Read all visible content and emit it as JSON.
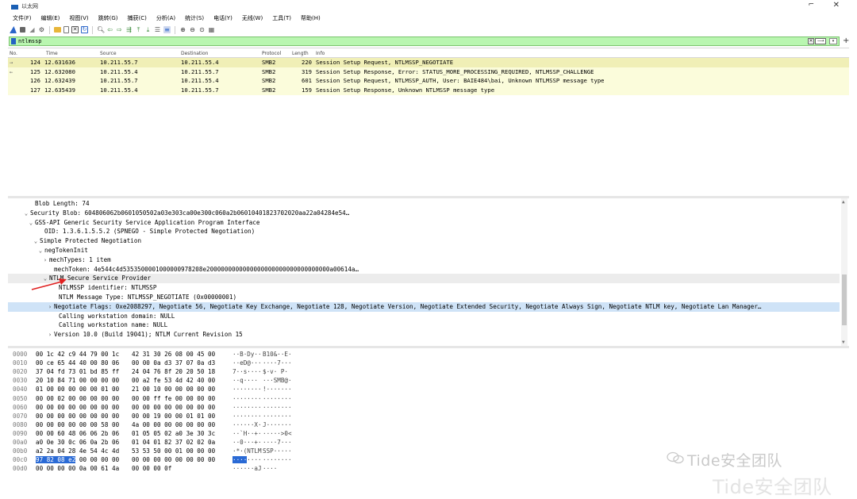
{
  "window": {
    "title": "以太网"
  },
  "menu": [
    "文件(F)",
    "编辑(E)",
    "视图(V)",
    "跳转(G)",
    "捕获(C)",
    "分析(A)",
    "统计(S)",
    "电话(Y)",
    "无线(W)",
    "工具(T)",
    "帮助(H)"
  ],
  "toolbar_icons": [
    "shark-fin-start-icon",
    "stop-icon",
    "restart-icon",
    "options-gear-icon",
    "open-folder-icon",
    "file-icon",
    "close-file-icon",
    "reload-icon",
    "find-icon",
    "go-back-icon",
    "go-forward-icon",
    "go-to-packet-icon",
    "go-first-icon",
    "go-last-icon",
    "autoscroll-icon",
    "colorize-icon",
    "zoom-in-icon",
    "zoom-out-icon",
    "zoom-reset-icon",
    "resize-columns-icon"
  ],
  "filter": {
    "value": "ntlmssp",
    "bg_color": "#b9f6b0"
  },
  "packet_list": {
    "columns": [
      "No.",
      "Time",
      "Source",
      "Destination",
      "Protocol",
      "Length",
      "Info"
    ],
    "rows": [
      {
        "arrow": "→",
        "no": "124",
        "time": "12.631636",
        "src": "10.211.55.7",
        "dst": "10.211.55.4",
        "proto": "SMB2",
        "len": "220",
        "info": "Session Setup Request, NTLMSSP_NEGOTIATE",
        "selected": true
      },
      {
        "arrow": "←",
        "no": "125",
        "time": "12.632080",
        "src": "10.211.55.4",
        "dst": "10.211.55.7",
        "proto": "SMB2",
        "len": "319",
        "info": "Session Setup Response, Error: STATUS_MORE_PROCESSING_REQUIRED, NTLMSSP_CHALLENGE",
        "selected": false
      },
      {
        "arrow": "",
        "no": "126",
        "time": "12.632439",
        "src": "10.211.55.7",
        "dst": "10.211.55.4",
        "proto": "SMB2",
        "len": "601",
        "info": "Session Setup Request, NTLMSSP_AUTH, User: BAIE484\\bai, Unknown NTLMSSP message type",
        "selected": false
      },
      {
        "arrow": "",
        "no": "127",
        "time": "12.635439",
        "src": "10.211.55.4",
        "dst": "10.211.55.7",
        "proto": "SMB2",
        "len": "159",
        "info": "Session Setup Response, Unknown NTLMSSP message type",
        "selected": false
      }
    ]
  },
  "details": [
    {
      "indent": 3,
      "toggle": "",
      "text": "Blob Length: 74"
    },
    {
      "indent": 2,
      "toggle": "v",
      "text": "Security Blob: 604806062b0601050502a03e303ca00e300c060a2b06010401823702020aa22a04284e54…"
    },
    {
      "indent": 3,
      "toggle": "v",
      "text": "GSS-API Generic Security Service Application Program Interface"
    },
    {
      "indent": 5,
      "toggle": "",
      "text": "OID: 1.3.6.1.5.5.2 (SPNEGO - Simple Protected Negotiation)"
    },
    {
      "indent": 4,
      "toggle": "v",
      "text": "Simple Protected Negotiation"
    },
    {
      "indent": 5,
      "toggle": "v",
      "text": "negTokenInit"
    },
    {
      "indent": 6,
      "toggle": ">",
      "text": "mechTypes: 1 item"
    },
    {
      "indent": 7,
      "toggle": "",
      "text": "mechToken: 4e544c4d5353500001000000978208e2000000000000000000000000000000000a00614a…"
    },
    {
      "indent": 6,
      "toggle": "v",
      "text": "NTLM Secure Service Provider",
      "hl": "gray"
    },
    {
      "indent": 8,
      "toggle": "",
      "text": "NTLMSSP identifier: NTLMSSP"
    },
    {
      "indent": 8,
      "toggle": "",
      "text": "NTLM Message Type: NTLMSSP_NEGOTIATE (0x00000001)"
    },
    {
      "indent": 7,
      "toggle": ">",
      "text": "Negotiate Flags: 0xe2088297, Negotiate 56, Negotiate Key Exchange, Negotiate 128, Negotiate Version, Negotiate Extended Security, Negotiate Always Sign, Negotiate NTLM key, Negotiate Lan Manager…",
      "hl": "blue"
    },
    {
      "indent": 8,
      "toggle": "",
      "text": "Calling workstation domain: NULL"
    },
    {
      "indent": 8,
      "toggle": "",
      "text": "Calling workstation name: NULL"
    },
    {
      "indent": 7,
      "toggle": ">",
      "text": "Version 10.0 (Build 19041); NTLM Current Revision 15"
    }
  ],
  "bytes": [
    {
      "off": "0000",
      "h1": "00 1c 42 c9 44 79 00 1c",
      "h2": "42 31 30 26 08 00 45 00",
      "a1": "··B·Dy··",
      "a2": "B10&··E·"
    },
    {
      "off": "0010",
      "h1": "00 ce 65 44 40 00 80 06",
      "h2": "00 00 0a d3 37 07 0a d3",
      "a1": "··eD@···",
      "a2": "····7···"
    },
    {
      "off": "0020",
      "h1": "37 04 fd 73 01 bd 85 ff",
      "h2": "24 04 76 8f 20 20 50 18",
      "a1": "7··s····",
      "a2": "$·v·  P·"
    },
    {
      "off": "0030",
      "h1": "20 10 84 71 00 00 00 00",
      "h2": "00 a2 fe 53 4d 42 40 00",
      "a1": " ··q····",
      "a2": "···SMB@·"
    },
    {
      "off": "0040",
      "h1": "01 00 00 00 00 00 01 00",
      "h2": "21 00 10 00 00 00 00 00",
      "a1": "········",
      "a2": "!·······"
    },
    {
      "off": "0050",
      "h1": "00 00 02 00 00 00 00 00",
      "h2": "00 00 ff fe 00 00 00 00",
      "a1": "········",
      "a2": "········"
    },
    {
      "off": "0060",
      "h1": "00 00 00 00 00 00 00 00",
      "h2": "00 00 00 00 00 00 00 00",
      "a1": "········",
      "a2": "········"
    },
    {
      "off": "0070",
      "h1": "00 00 00 00 00 00 00 00",
      "h2": "00 00 19 00 00 01 01 00",
      "a1": "········",
      "a2": "········"
    },
    {
      "off": "0080",
      "h1": "00 00 00 00 00 00 58 00",
      "h2": "4a 00 00 00 00 00 00 00",
      "a1": "······X·",
      "a2": "J·······"
    },
    {
      "off": "0090",
      "h1": "00 00 60 48 06 06 2b 06",
      "h2": "01 05 05 02 a0 3e 30 3c",
      "a1": "··`H··+·",
      "a2": "·····>0<"
    },
    {
      "off": "00a0",
      "h1": "a0 0e 30 0c 06 0a 2b 06",
      "h2": "01 04 01 82 37 02 02 0a",
      "a1": "··0···+·",
      "a2": "····7···"
    },
    {
      "off": "00b0",
      "h1": "a2 2a 04 28 4e 54 4c 4d",
      "h2": "53 53 50 00 01 00 00 00",
      "a1": "·*·(NTLM",
      "a2": "SSP·····"
    },
    {
      "off": "00c0",
      "h1": "97 82 08 e2",
      "h1b": " 00 00 00 00",
      "h2": "00 00 00 00 00 00 00 00",
      "a1": "····",
      "a1b": "····",
      "a2": "········",
      "sel": true
    },
    {
      "off": "00d0",
      "h1": "00 00 00 00 0a 00 61 4a",
      "h2": "00 00 00 0f",
      "a1": "······aJ",
      "a2": "····"
    }
  ],
  "watermark": {
    "line1": "Tide安全团队",
    "line2": "Tide安全团队"
  }
}
